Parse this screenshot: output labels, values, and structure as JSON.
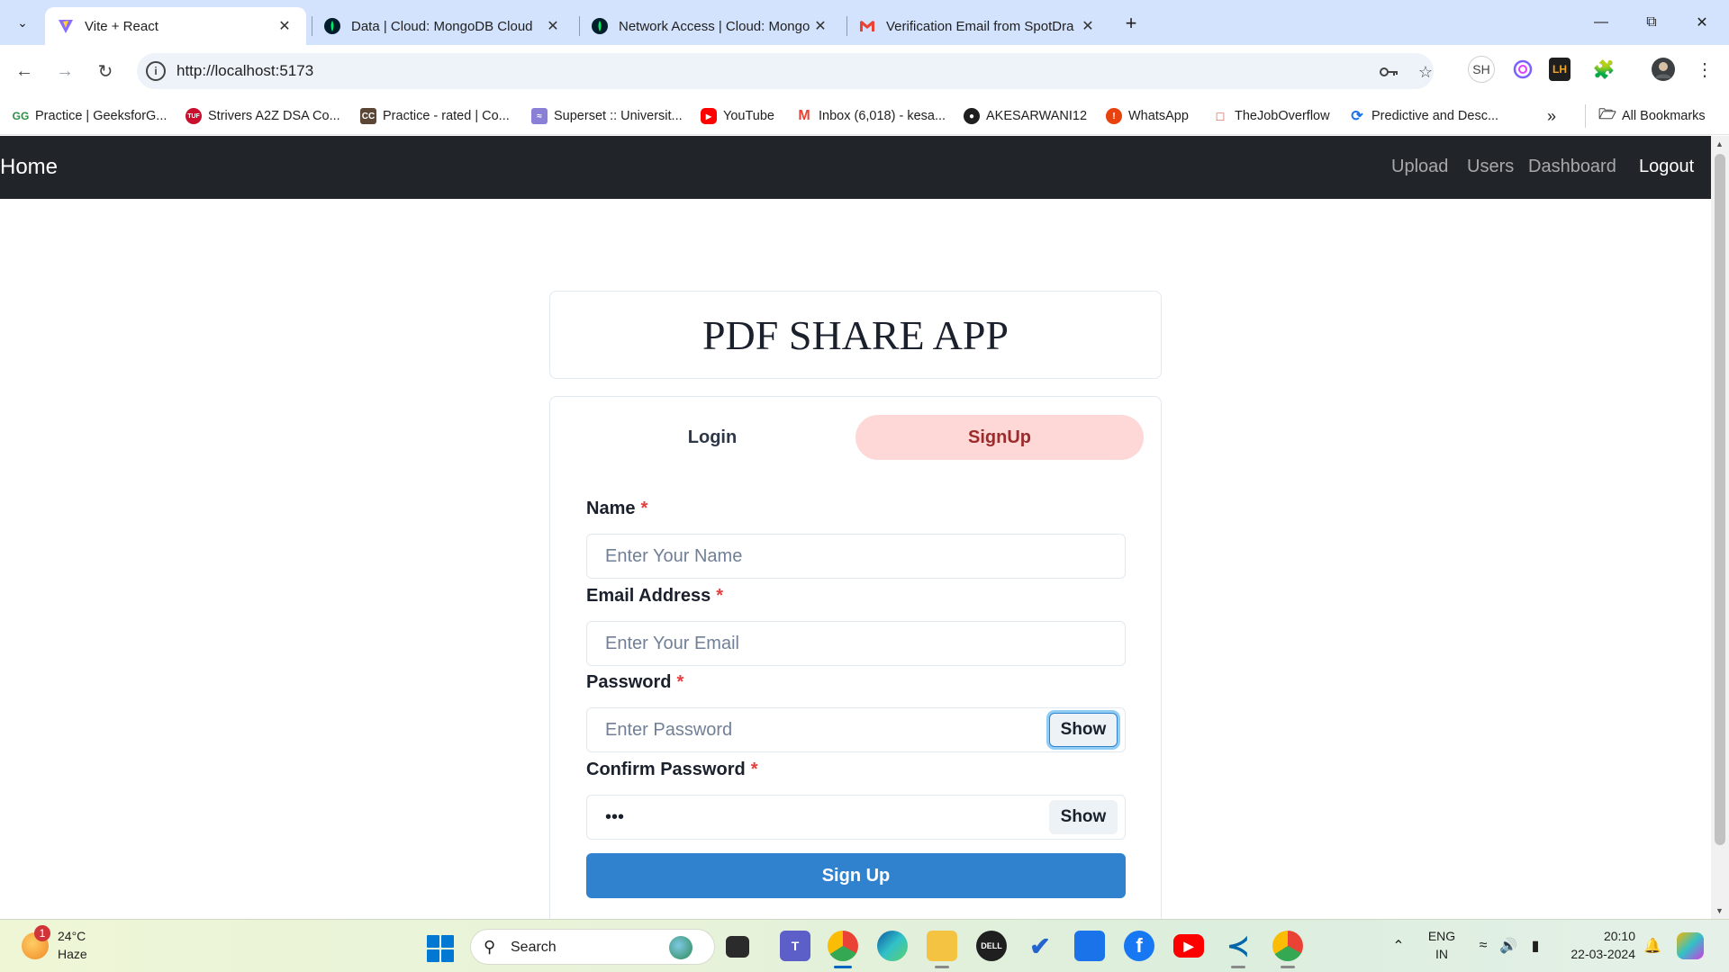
{
  "browser": {
    "tabs": [
      {
        "title": "Vite + React",
        "active": true
      },
      {
        "title": "Data | Cloud: MongoDB Cloud",
        "active": false
      },
      {
        "title": "Network Access | Cloud: Mongo",
        "active": false
      },
      {
        "title": "Verification Email from SpotDra",
        "active": false
      }
    ],
    "url": "http://localhost:5173",
    "profile_initials": "SH",
    "extension_label": "LH",
    "bookmarks": [
      "Practice | GeeksforG...",
      "Strivers A2Z DSA Co...",
      "Practice - rated | Co...",
      "Superset :: Universit...",
      "YouTube",
      "Inbox (6,018) - kesa...",
      "AKESARWANI12",
      "WhatsApp",
      "TheJobOverflow",
      "Predictive and Desc..."
    ],
    "all_bookmarks": "All Bookmarks"
  },
  "navbar": {
    "home": "Home",
    "links": [
      "Upload",
      "Users",
      "Dashboard"
    ],
    "logout": "Logout"
  },
  "app": {
    "title": "PDF SHARE APP",
    "tabs": {
      "login": "Login",
      "signup": "SignUp",
      "selected": "SignUp"
    },
    "form": {
      "name_label": "Name",
      "name_placeholder": "Enter Your Name",
      "email_label": "Email Address",
      "email_placeholder": "Enter Your Email",
      "password_label": "Password",
      "password_placeholder": "Enter Password",
      "confirm_label": "Confirm Password",
      "confirm_value": "***",
      "show_label": "Show",
      "required_mark": "*",
      "submit_label": "Sign Up"
    },
    "colors": {
      "selected_tab_bg": "#fed7d7",
      "submit_bg": "#3182ce",
      "navbar_bg": "#212529"
    }
  },
  "taskbar": {
    "weather_temp": "24°C",
    "weather_cond": "Haze",
    "weather_badge": "1",
    "search_label": "Search",
    "language": "ENG",
    "region": "IN",
    "time": "20:10",
    "date": "22-03-2024"
  }
}
